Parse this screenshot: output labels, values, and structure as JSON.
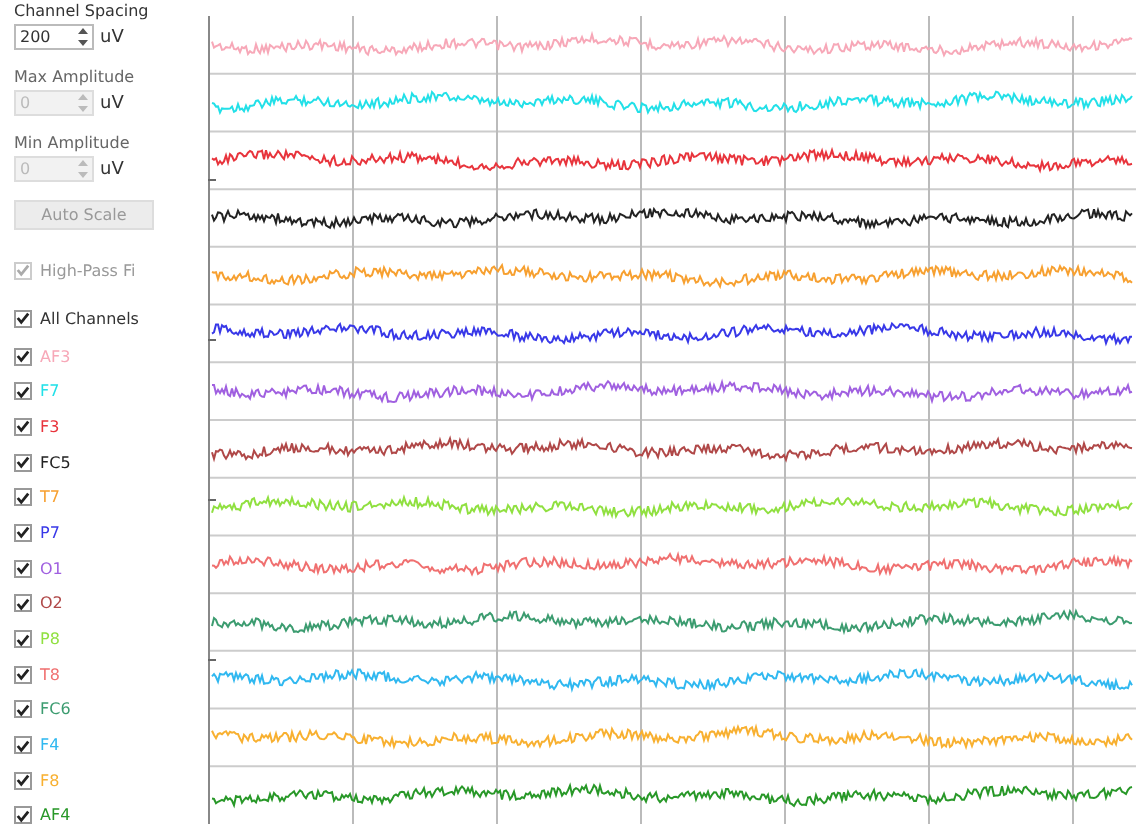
{
  "controls": {
    "channel_spacing": {
      "label": "Channel Spacing",
      "value": "200",
      "unit": "uV",
      "disabled": false
    },
    "max_amplitude": {
      "label": "Max Amplitude",
      "value": "0",
      "unit": "uV",
      "disabled": true
    },
    "min_amplitude": {
      "label": "Min Amplitude",
      "value": "0",
      "unit": "uV",
      "disabled": true
    },
    "auto_scale": {
      "label": "Auto Scale",
      "disabled": true
    },
    "high_pass": {
      "label": "High-Pass Fi",
      "checked": true,
      "disabled": true
    },
    "all_channels": {
      "label": "All Channels",
      "checked": true,
      "disabled": false
    }
  },
  "channels": [
    {
      "name": "AF3",
      "checked": true,
      "color": "#f7a8b8"
    },
    {
      "name": "F7",
      "checked": true,
      "color": "#22e0e8"
    },
    {
      "name": "F3",
      "checked": true,
      "color": "#e8343c"
    },
    {
      "name": "FC5",
      "checked": true,
      "color": "#222222"
    },
    {
      "name": "T7",
      "checked": true,
      "color": "#f7a030"
    },
    {
      "name": "P7",
      "checked": true,
      "color": "#3838e8"
    },
    {
      "name": "O1",
      "checked": true,
      "color": "#a060e0"
    },
    {
      "name": "O2",
      "checked": true,
      "color": "#b04848"
    },
    {
      "name": "P8",
      "checked": true,
      "color": "#90e040"
    },
    {
      "name": "T8",
      "checked": true,
      "color": "#f07070"
    },
    {
      "name": "FC6",
      "checked": true,
      "color": "#3c9c70"
    },
    {
      "name": "F4",
      "checked": true,
      "color": "#30b8f0"
    },
    {
      "name": "F8",
      "checked": true,
      "color": "#f8b030"
    },
    {
      "name": "AF4",
      "checked": true,
      "color": "#289828"
    }
  ]
}
